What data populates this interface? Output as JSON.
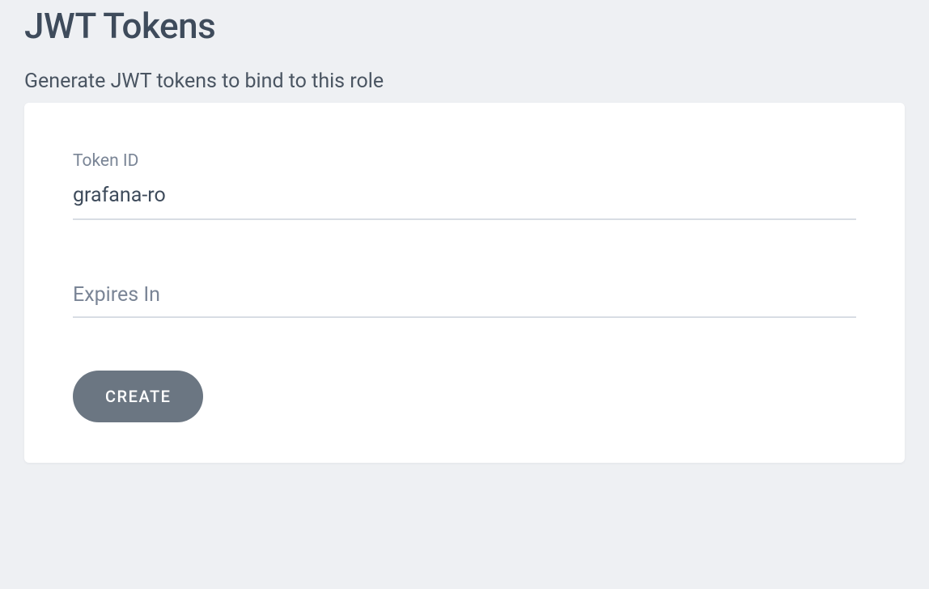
{
  "page": {
    "title": "JWT Tokens",
    "subtitle": "Generate JWT tokens to bind to this role"
  },
  "form": {
    "token_id": {
      "label": "Token ID",
      "value": "grafana-ro"
    },
    "expires_in": {
      "label": "Expires In",
      "value": ""
    },
    "create_button_label": "CREATE"
  }
}
